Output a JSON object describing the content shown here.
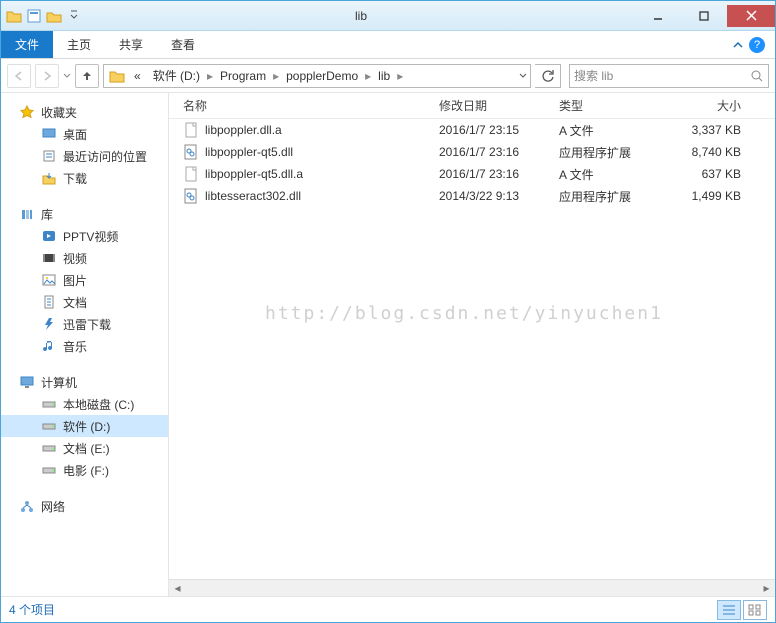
{
  "window": {
    "title": "lib"
  },
  "ribbon": {
    "file": "文件",
    "home": "主页",
    "share": "共享",
    "view": "查看"
  },
  "address": {
    "prefix": "«",
    "crumbs": [
      "软件 (D:)",
      "Program",
      "popplerDemo",
      "lib"
    ]
  },
  "search": {
    "placeholder": "搜索 lib"
  },
  "sidebar": {
    "favorites": {
      "label": "收藏夹",
      "items": [
        "桌面",
        "最近访问的位置",
        "下载"
      ]
    },
    "libraries": {
      "label": "库",
      "items": [
        "PPTV视频",
        "视频",
        "图片",
        "文档",
        "迅雷下载",
        "音乐"
      ]
    },
    "computer": {
      "label": "计算机",
      "items": [
        "本地磁盘 (C:)",
        "软件 (D:)",
        "文档 (E:)",
        "电影 (F:)"
      ],
      "selected": "软件 (D:)"
    },
    "network": {
      "label": "网络"
    }
  },
  "columns": {
    "name": "名称",
    "date": "修改日期",
    "type": "类型",
    "size": "大小"
  },
  "files": [
    {
      "icon": "file",
      "name": "libpoppler.dll.a",
      "date": "2016/1/7 23:15",
      "type": "A 文件",
      "size": "3,337 KB"
    },
    {
      "icon": "dll",
      "name": "libpoppler-qt5.dll",
      "date": "2016/1/7 23:16",
      "type": "应用程序扩展",
      "size": "8,740 KB"
    },
    {
      "icon": "file",
      "name": "libpoppler-qt5.dll.a",
      "date": "2016/1/7 23:16",
      "type": "A 文件",
      "size": "637 KB"
    },
    {
      "icon": "dll",
      "name": "libtesseract302.dll",
      "date": "2014/3/22 9:13",
      "type": "应用程序扩展",
      "size": "1,499 KB"
    }
  ],
  "watermark": "http://blog.csdn.net/yinyuchen1",
  "status": {
    "count": "4 个项目"
  }
}
